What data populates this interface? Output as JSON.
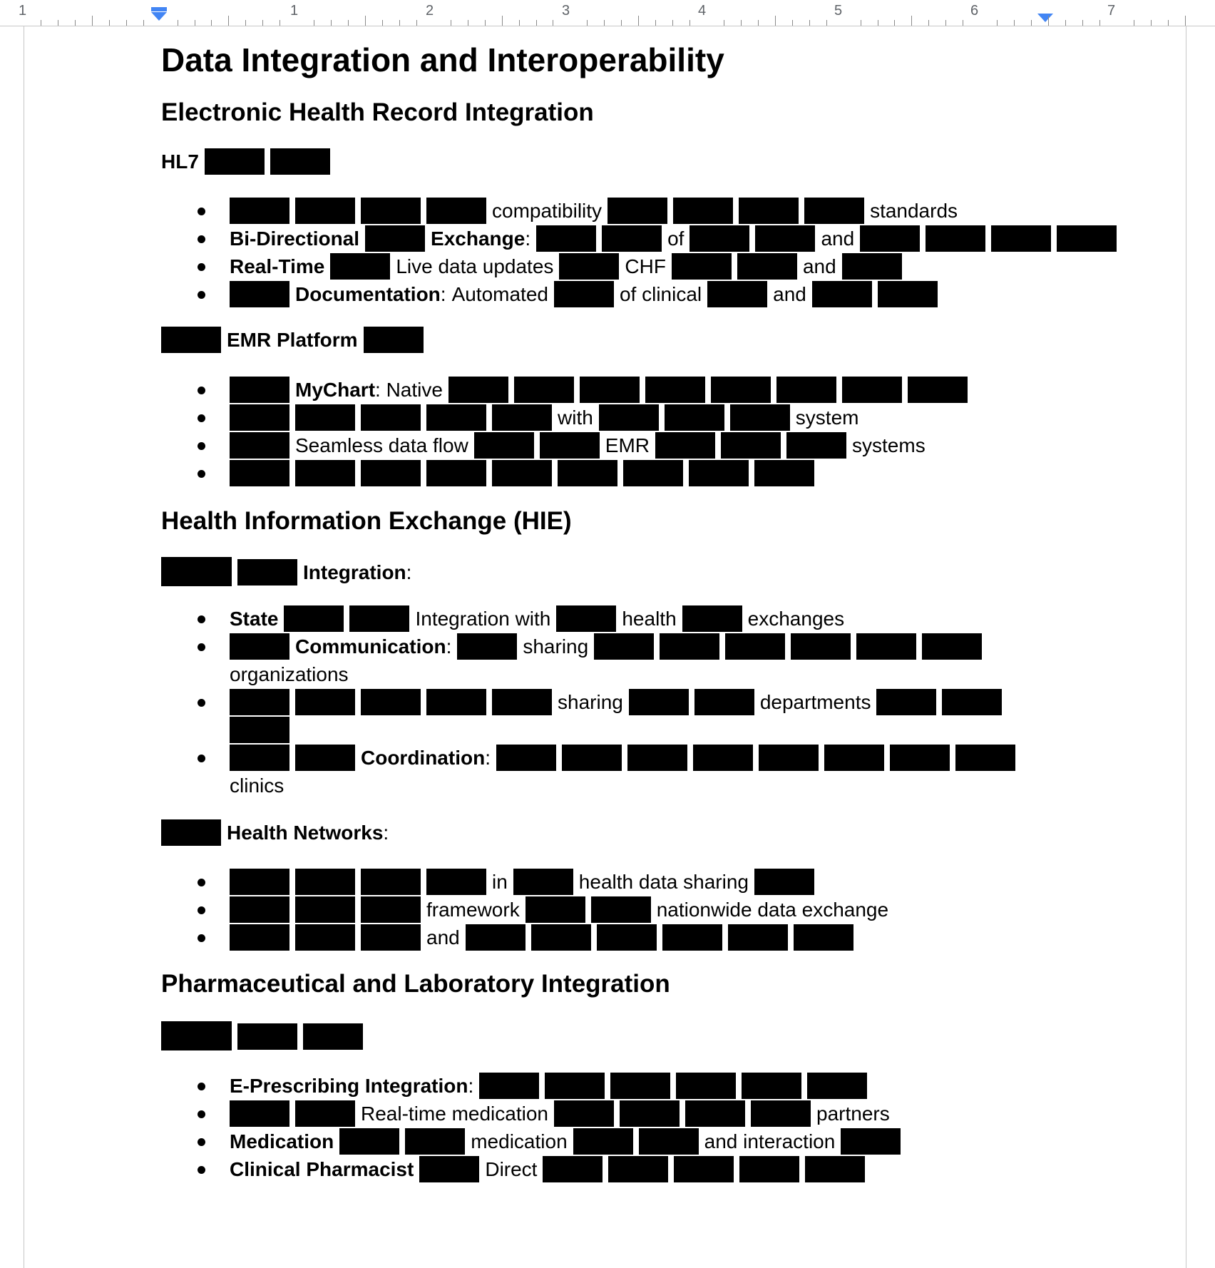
{
  "ruler": {
    "numbers": [
      "1",
      "1",
      "2",
      "3",
      "4",
      "5",
      "6",
      "7"
    ]
  },
  "doc": {
    "title": "Data Integration and Interoperability",
    "s1": {
      "heading": "Electronic Health Record Integration",
      "hl7": {
        "heading": "HL7"
      },
      "hl7_items": [
        {
          "a": "compatibility",
          "b": "standards"
        },
        {
          "bold1": "Bi-Directional",
          "bold2": "Exchange",
          "colon": ":",
          "a": "of",
          "b": "and"
        },
        {
          "bold1": "Real-Time",
          "a": "Live data updates",
          "b": "CHF",
          "c": "and"
        },
        {
          "bold1": "Documentation",
          "colon": ":",
          "a": "Automated",
          "b": "of clinical",
          "c": "and"
        }
      ],
      "emr": {
        "heading": "EMR Platform"
      },
      "emr_items": [
        {
          "bold1": "MyChart",
          "colon": ":",
          "a": "Native"
        },
        {
          "a": "with",
          "b": "system"
        },
        {
          "a": "Seamless data flow",
          "b": "EMR",
          "c": "systems"
        },
        {}
      ]
    },
    "s2": {
      "heading": "Health Information Exchange (HIE)",
      "integration": {
        "heading": "Integration",
        "colon": ":"
      },
      "integration_items": [
        {
          "bold1": "State",
          "a": "Integration with",
          "b": "health",
          "c": "exchanges"
        },
        {
          "bold1": "Communication",
          "colon": ":",
          "a": "sharing",
          "b": "organizations"
        },
        {
          "a": "sharing",
          "b": "departments"
        },
        {
          "bold1": "Coordination",
          "colon": ":",
          "a": "clinics"
        }
      ],
      "networks": {
        "heading": "Health Networks",
        "colon": ":"
      },
      "network_items": [
        {
          "a": "in",
          "b": "health data sharing"
        },
        {
          "a": "framework",
          "b": "nationwide data exchange"
        },
        {
          "a": "and"
        }
      ]
    },
    "s3": {
      "heading": "Pharmaceutical and Laboratory Integration",
      "items": [
        {
          "bold1": "E-Prescribing Integration",
          "colon": ":"
        },
        {
          "a": "Real-time medication",
          "b": "partners"
        },
        {
          "bold1": "Medication",
          "a": "medication",
          "b": "and interaction"
        },
        {
          "bold1": "Clinical Pharmacist",
          "a": "Direct"
        }
      ]
    }
  }
}
